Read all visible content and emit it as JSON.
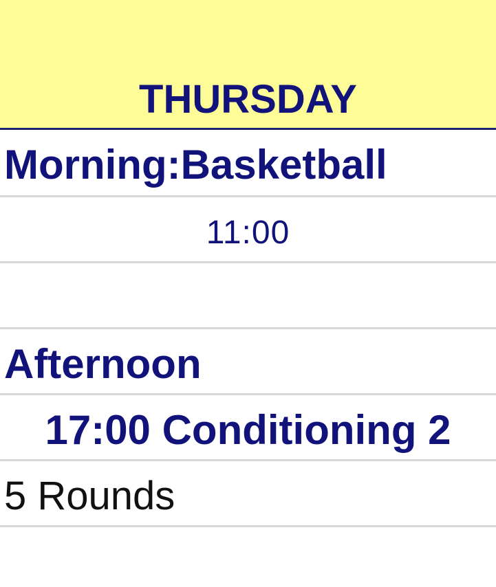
{
  "header": {
    "day": "THURSDAY"
  },
  "schedule": {
    "morning_label": "Morning:Basketball",
    "morning_time": "11:00",
    "empty_row": "",
    "afternoon_label": "Afternoon",
    "afternoon_session": "17:00 Conditioning 2",
    "afternoon_detail": "5 Rounds"
  },
  "colors": {
    "header_bg": "#fefc96",
    "title_text": "#12137a",
    "grid_line": "#d9d9d9",
    "detail_text": "#111111"
  }
}
